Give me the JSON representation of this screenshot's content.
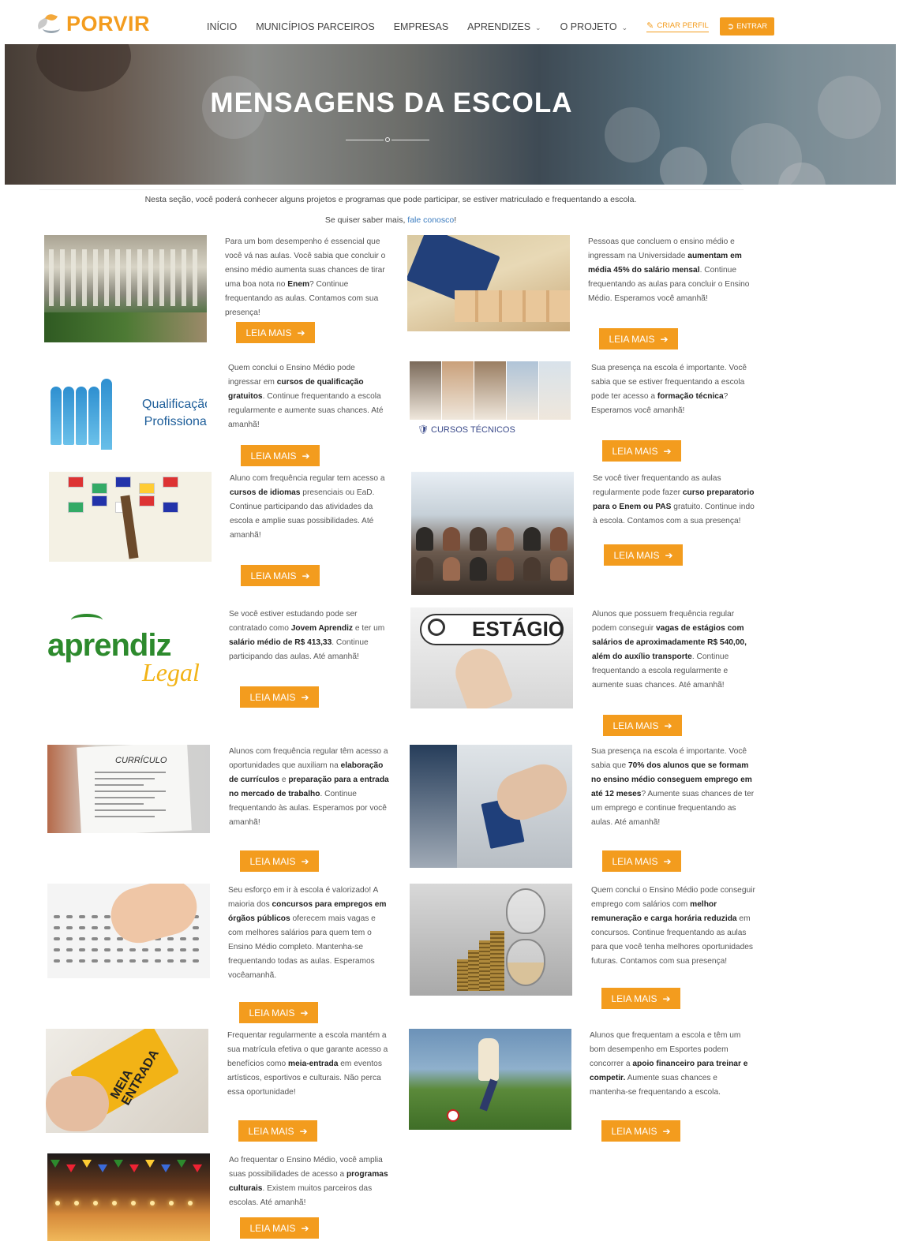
{
  "brand": {
    "name": "PORVIR",
    "color": "#f39c1e"
  },
  "nav": {
    "items": [
      {
        "label": "INÍCIO"
      },
      {
        "label": "MUNICÍPIOS PARCEIROS"
      },
      {
        "label": "EMPRESAS"
      },
      {
        "label": "APRENDIZES",
        "dropdown": true
      },
      {
        "label": "O PROJETO",
        "dropdown": true
      }
    ],
    "criar_perfil": "CRIAR PERFIL",
    "entrar": "ENTRAR"
  },
  "hero": {
    "title": "MENSAGENS DA ESCOLA"
  },
  "intro": {
    "line1": "Nesta seção, você poderá conhecer alguns projetos e programas que pode participar, se estiver matriculado e frequentando a escola.",
    "line2_prefix": "Se quiser saber mais, ",
    "line2_link": "fale conosco",
    "line2_suffix": "!"
  },
  "button_label": "LEIA MAIS",
  "cards": [
    {
      "id": "aulas",
      "image": "school-courtyard-photo",
      "segments": [
        "Para um bom desempenho é essencial que você vá nas aulas. Você sabia que concluir o ensino médio aumenta suas chances de tirar uma boa nota no ",
        "*Enem",
        "? Continue frequentando as aulas. Contamos com sua presença!"
      ]
    },
    {
      "id": "salario",
      "image": "work-card-money-photo",
      "segments": [
        "Pessoas que concluem o ensino médio e ingressam na Universidade ",
        "*aumentam em média 45% do salário mensal",
        ". Continue frequentando as aulas para concluir o Ensino Médio. Esperamos você amanhã!"
      ]
    },
    {
      "id": "qualificacao",
      "image": "qualificacao-profissional-graphic",
      "image_text": [
        "Qualificação",
        "Profissional"
      ],
      "segments": [
        "Quem conclui o Ensino Médio pode ingressar em ",
        "*cursos de qualificação gratuitos",
        ". Continue frequentando a escola regularmente e aumente suas chances. Até amanhã!"
      ]
    },
    {
      "id": "tecnica",
      "image": "cursos-tecnicos-collage",
      "image_text": [
        "CURSOS TÉCNICOS"
      ],
      "segments": [
        "Sua presença na escola é importante. Você sabia que se estiver frequentando a escola pode ter acesso a ",
        "*formação técnica",
        "? Esperamos você amanhã!"
      ]
    },
    {
      "id": "idiomas",
      "image": "flags-tree-illustration",
      "segments": [
        "Aluno com frequência regular tem acesso a ",
        "*cursos de idiomas",
        " presenciais ou EaD. Continue participando das atividades da escola e amplie suas possibilidades. Até amanhã!"
      ]
    },
    {
      "id": "preparatorio",
      "image": "classroom-photo",
      "segments": [
        "Se você tiver frequentando as aulas regularmente pode fazer ",
        "*curso preparatorio para o Enem ou PAS",
        " gratuito. Continue indo à escola. Contamos com a sua presença!"
      ]
    },
    {
      "id": "aprendiz",
      "image": "aprendiz-legal-logo",
      "image_text": [
        "aprendiz",
        "Legal"
      ],
      "segments": [
        "Se você estiver estudando pode ser contratado como ",
        "*Jovem Aprendiz",
        " e ter um ",
        "*salário médio de R$ 413,33",
        ". Continue participando das aulas. Até amanhã!"
      ]
    },
    {
      "id": "estagio",
      "image": "estagio-search-graphic",
      "image_text": [
        "ESTÁGIO"
      ],
      "segments": [
        "Alunos que possuem frequência regular podem conseguir ",
        "*vagas de estágios com salários de aproximadamente R$ 540,00, além do auxílio transporte",
        ". Continue frequentando a escola regularmente e aumente suas chances. Até amanhã!"
      ]
    },
    {
      "id": "curriculo",
      "image": "curriculo-photo",
      "image_text": [
        "CURRÍCULO"
      ],
      "segments": [
        "Alunos com frequência regular têm acesso a oportunidades que auxiliam na ",
        "*elaboração de currículos",
        " e ",
        "*preparação para a entrada no mercado de trabalho",
        ". Continue frequentando às aulas. Esperamos por você amanhã!"
      ]
    },
    {
      "id": "emprego",
      "image": "work-card-handover-photo",
      "segments": [
        "Sua presença na escola é importante. Você sabia que ",
        "*70% dos alunos que se formam no ensino médio conseguem emprego em até 12 meses",
        "? Aumente suas chances de ter um emprego e continue frequentando as aulas. Até amanhã!"
      ]
    },
    {
      "id": "concursos",
      "image": "exam-answer-sheet-photo",
      "segments": [
        "Seu esforço em ir à escola é valorizado! A maioria dos ",
        "*concursos para empregos em órgãos públicos",
        " oferecem mais vagas e com melhores salários para quem tem o Ensino Médio completo. Mantenha-se frequentando todas as aulas. Esperamos vocêamanhã."
      ]
    },
    {
      "id": "remuneracao",
      "image": "hourglass-coins-photo",
      "segments": [
        "Quem conclui o Ensino Médio pode conseguir emprego com salários com ",
        "*melhor remuneração e carga horária reduzida",
        " em concursos. Continue frequentando as aulas para que você tenha melhores oportunidades futuras. Contamos com sua presença!"
      ]
    },
    {
      "id": "meia",
      "image": "meia-entrada-ticket-photo",
      "image_text": [
        "MEIA",
        "ENTRADA"
      ],
      "segments": [
        "Frequentar regularmente a escola mantém a sua matrícula efetiva o que garante acesso a benefícios como ",
        "*meia-entrada",
        " em eventos artísticos, esportivos e culturais. Não perca essa oportunidade!"
      ]
    },
    {
      "id": "esportes",
      "image": "soccer-player-photo",
      "segments": [
        "Alunos que frequentam a escola e têm um bom desempenho em Esportes podem concorrer a ",
        "*apoio financeiro para treinar e competir.",
        " Aumente suas chances e mantenha-se frequentando a escola."
      ]
    },
    {
      "id": "cultura",
      "image": "festival-street-photo",
      "segments": [
        "Ao frequentar o Ensino Médio, você amplia suas possibilidades de acesso a ",
        "*programas culturais",
        ". Existem muitos parceiros das escolas. Até amanhã!"
      ]
    }
  ]
}
